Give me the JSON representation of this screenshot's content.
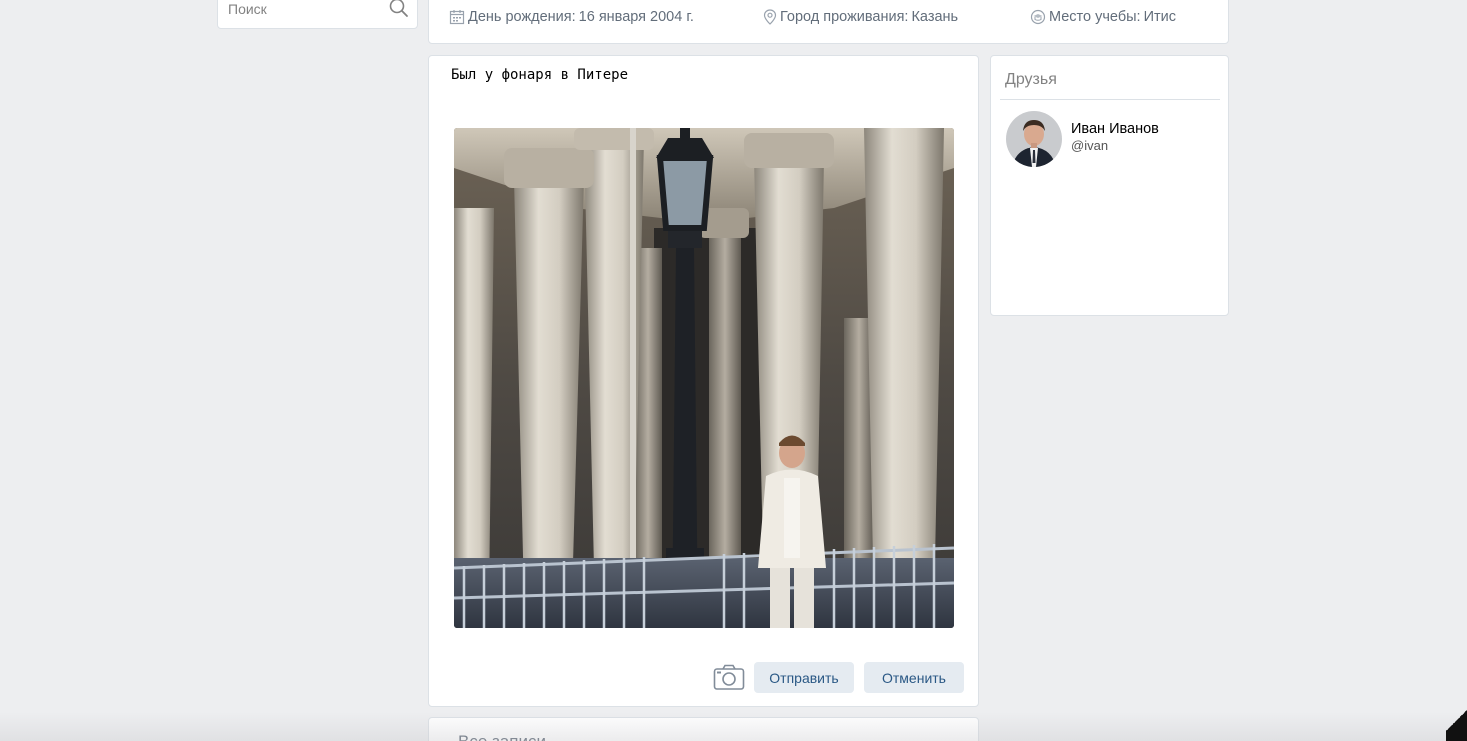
{
  "search": {
    "placeholder": "Поиск"
  },
  "profile_info": {
    "birthday": {
      "label": "День рождения:",
      "value": "16 января 2004 г."
    },
    "city": {
      "label": "Город проживания:",
      "value": "Казань"
    },
    "study": {
      "label": "Место учебы:",
      "value": "Итис"
    }
  },
  "post": {
    "text": "Был у фонаря в Питере",
    "send_label": "Отправить",
    "cancel_label": "Отменить"
  },
  "friends": {
    "title": "Друзья",
    "items": [
      {
        "name": "Иван Иванов",
        "handle": "@ivan"
      }
    ]
  },
  "all_posts": {
    "title": "Все записи"
  },
  "colors": {
    "page_bg": "#edeef0",
    "card_bg": "#ffffff",
    "border": "#dce1e6",
    "muted_text": "#626d7a",
    "button_bg": "#e5ebf1",
    "button_text": "#2a5885"
  }
}
